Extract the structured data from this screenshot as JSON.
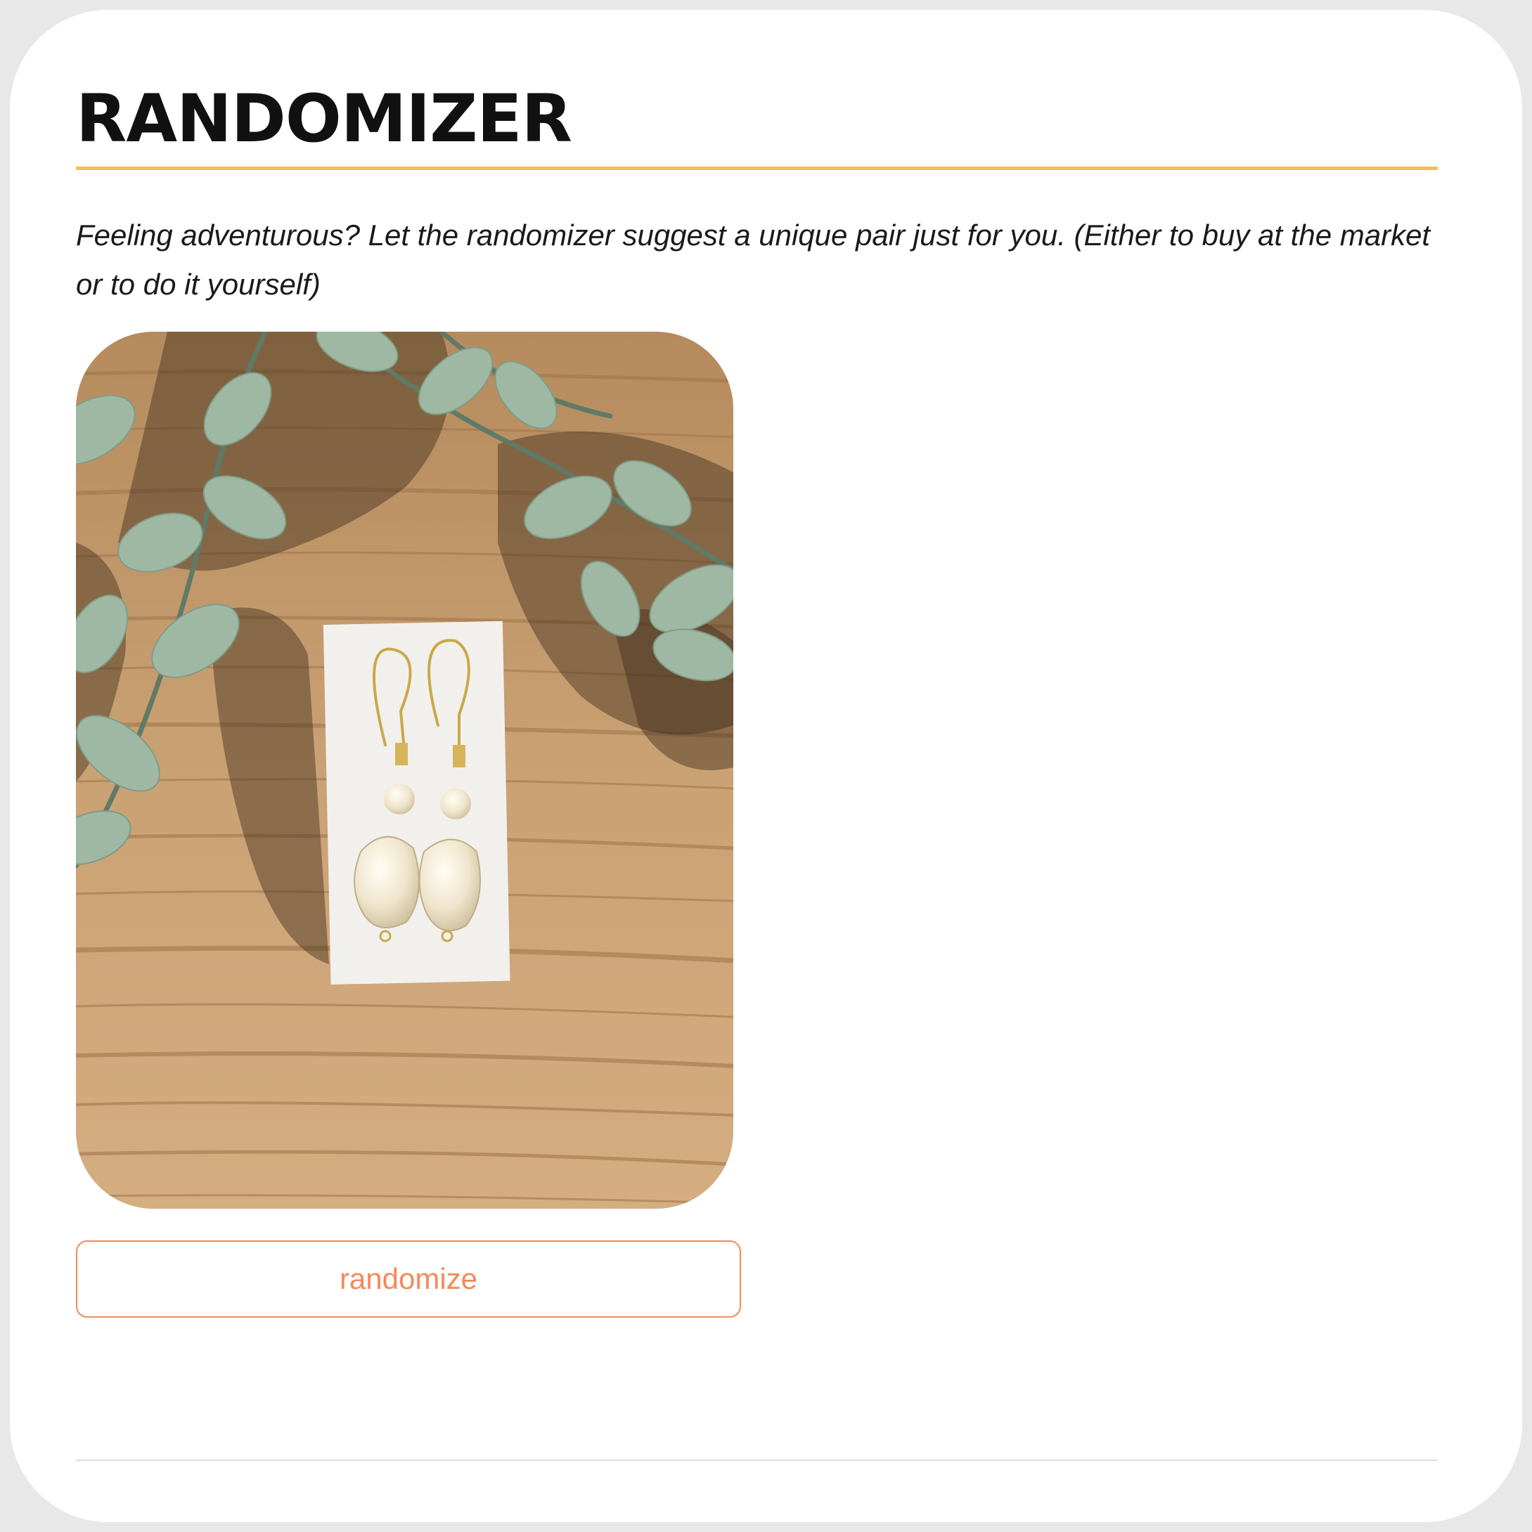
{
  "section": {
    "title": "RANDOMIZER",
    "description": "Feeling adventurous? Let the randomizer suggest a unique pair just for you. (Either to buy at the market or to do it yourself)"
  },
  "suggestion": {
    "image_alt": "Pearl drop earrings on a white card over a wooden surface with eucalyptus leaves"
  },
  "actions": {
    "randomize_label": "randomize"
  },
  "colors": {
    "accent_rule": "#f5bf4f",
    "button_accent": "#f48a57"
  }
}
